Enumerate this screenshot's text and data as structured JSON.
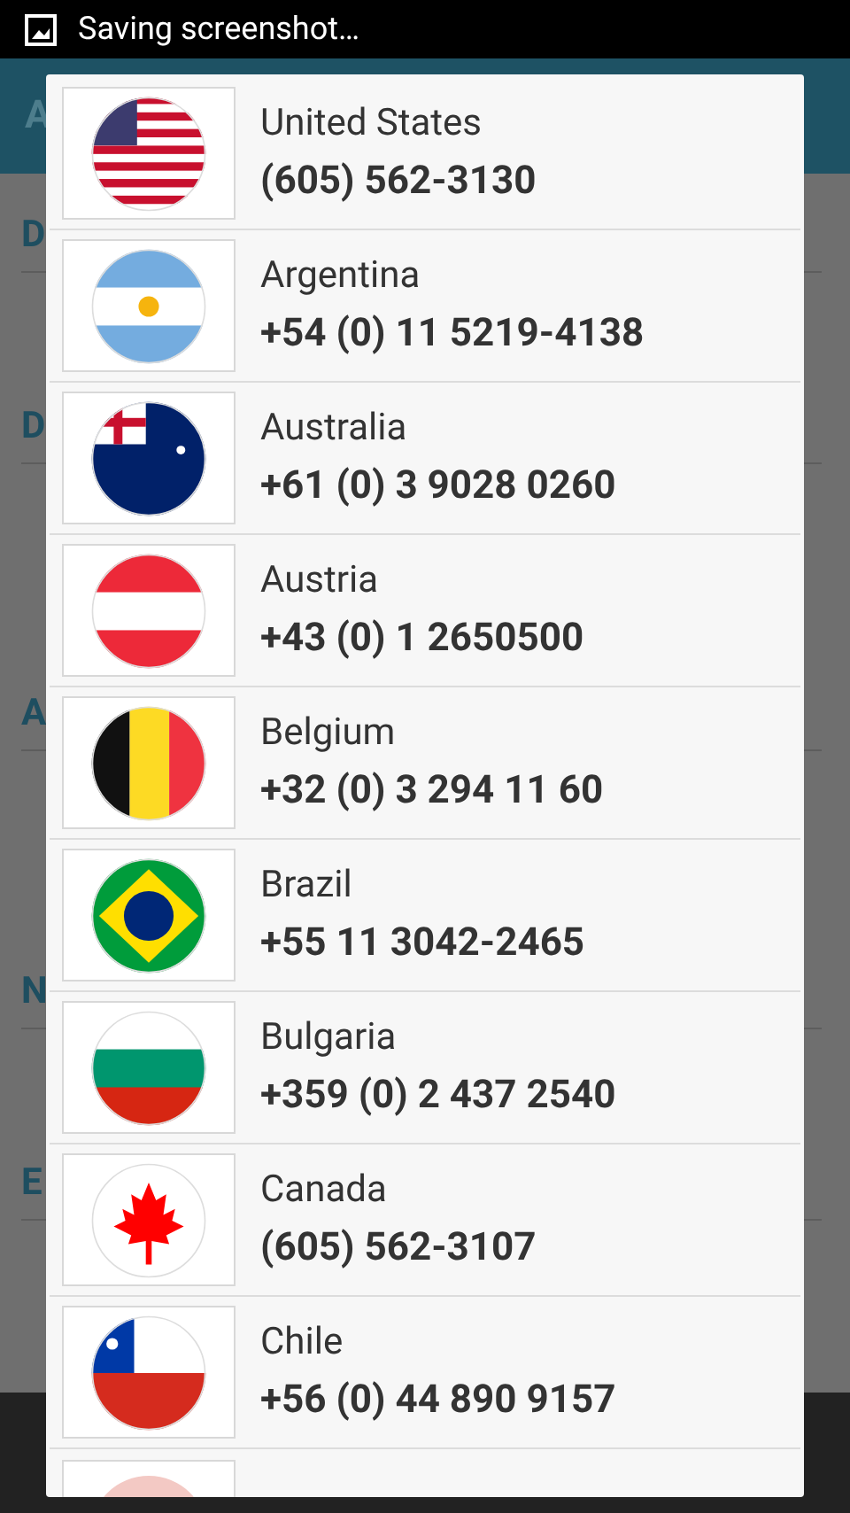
{
  "status_bar": {
    "notification": "Saving screenshot…"
  },
  "background": {
    "app_bar_title": "A",
    "section_letters": [
      "D",
      "D",
      "A",
      "N",
      "E"
    ]
  },
  "countries": [
    {
      "name": "United States",
      "phone": "(605) 562-3130",
      "kind": "us"
    },
    {
      "name": "Argentina",
      "phone": "+54 (0) 11 5219-4138",
      "kind": "ar"
    },
    {
      "name": "Australia",
      "phone": "+61 (0) 3 9028 0260",
      "kind": "au"
    },
    {
      "name": "Austria",
      "phone": "+43 (0) 1 2650500",
      "kind": "at"
    },
    {
      "name": "Belgium",
      "phone": "+32 (0) 3 294 11 60",
      "kind": "be"
    },
    {
      "name": "Brazil",
      "phone": "+55 11 3042-2465",
      "kind": "br"
    },
    {
      "name": "Bulgaria",
      "phone": "+359 (0) 2 437 2540",
      "kind": "bg"
    },
    {
      "name": "Canada",
      "phone": "(605) 562-3107",
      "kind": "ca"
    },
    {
      "name": "Chile",
      "phone": "+56 (0) 44 890 9157",
      "kind": "cl"
    }
  ]
}
